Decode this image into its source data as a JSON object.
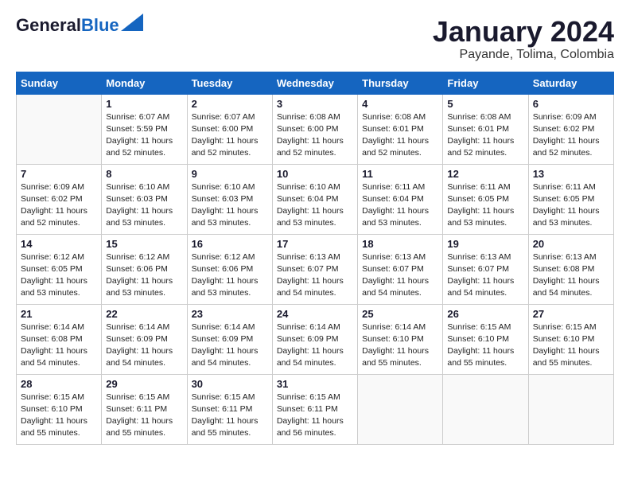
{
  "header": {
    "logo_line1": "General",
    "logo_line2": "Blue",
    "title": "January 2024",
    "subtitle": "Payande, Tolima, Colombia"
  },
  "days_of_week": [
    "Sunday",
    "Monday",
    "Tuesday",
    "Wednesday",
    "Thursday",
    "Friday",
    "Saturday"
  ],
  "weeks": [
    [
      {
        "num": "",
        "info": ""
      },
      {
        "num": "1",
        "info": "Sunrise: 6:07 AM\nSunset: 5:59 PM\nDaylight: 11 hours\nand 52 minutes."
      },
      {
        "num": "2",
        "info": "Sunrise: 6:07 AM\nSunset: 6:00 PM\nDaylight: 11 hours\nand 52 minutes."
      },
      {
        "num": "3",
        "info": "Sunrise: 6:08 AM\nSunset: 6:00 PM\nDaylight: 11 hours\nand 52 minutes."
      },
      {
        "num": "4",
        "info": "Sunrise: 6:08 AM\nSunset: 6:01 PM\nDaylight: 11 hours\nand 52 minutes."
      },
      {
        "num": "5",
        "info": "Sunrise: 6:08 AM\nSunset: 6:01 PM\nDaylight: 11 hours\nand 52 minutes."
      },
      {
        "num": "6",
        "info": "Sunrise: 6:09 AM\nSunset: 6:02 PM\nDaylight: 11 hours\nand 52 minutes."
      }
    ],
    [
      {
        "num": "7",
        "info": "Sunrise: 6:09 AM\nSunset: 6:02 PM\nDaylight: 11 hours\nand 52 minutes."
      },
      {
        "num": "8",
        "info": "Sunrise: 6:10 AM\nSunset: 6:03 PM\nDaylight: 11 hours\nand 53 minutes."
      },
      {
        "num": "9",
        "info": "Sunrise: 6:10 AM\nSunset: 6:03 PM\nDaylight: 11 hours\nand 53 minutes."
      },
      {
        "num": "10",
        "info": "Sunrise: 6:10 AM\nSunset: 6:04 PM\nDaylight: 11 hours\nand 53 minutes."
      },
      {
        "num": "11",
        "info": "Sunrise: 6:11 AM\nSunset: 6:04 PM\nDaylight: 11 hours\nand 53 minutes."
      },
      {
        "num": "12",
        "info": "Sunrise: 6:11 AM\nSunset: 6:05 PM\nDaylight: 11 hours\nand 53 minutes."
      },
      {
        "num": "13",
        "info": "Sunrise: 6:11 AM\nSunset: 6:05 PM\nDaylight: 11 hours\nand 53 minutes."
      }
    ],
    [
      {
        "num": "14",
        "info": "Sunrise: 6:12 AM\nSunset: 6:05 PM\nDaylight: 11 hours\nand 53 minutes."
      },
      {
        "num": "15",
        "info": "Sunrise: 6:12 AM\nSunset: 6:06 PM\nDaylight: 11 hours\nand 53 minutes."
      },
      {
        "num": "16",
        "info": "Sunrise: 6:12 AM\nSunset: 6:06 PM\nDaylight: 11 hours\nand 53 minutes."
      },
      {
        "num": "17",
        "info": "Sunrise: 6:13 AM\nSunset: 6:07 PM\nDaylight: 11 hours\nand 54 minutes."
      },
      {
        "num": "18",
        "info": "Sunrise: 6:13 AM\nSunset: 6:07 PM\nDaylight: 11 hours\nand 54 minutes."
      },
      {
        "num": "19",
        "info": "Sunrise: 6:13 AM\nSunset: 6:07 PM\nDaylight: 11 hours\nand 54 minutes."
      },
      {
        "num": "20",
        "info": "Sunrise: 6:13 AM\nSunset: 6:08 PM\nDaylight: 11 hours\nand 54 minutes."
      }
    ],
    [
      {
        "num": "21",
        "info": "Sunrise: 6:14 AM\nSunset: 6:08 PM\nDaylight: 11 hours\nand 54 minutes."
      },
      {
        "num": "22",
        "info": "Sunrise: 6:14 AM\nSunset: 6:09 PM\nDaylight: 11 hours\nand 54 minutes."
      },
      {
        "num": "23",
        "info": "Sunrise: 6:14 AM\nSunset: 6:09 PM\nDaylight: 11 hours\nand 54 minutes."
      },
      {
        "num": "24",
        "info": "Sunrise: 6:14 AM\nSunset: 6:09 PM\nDaylight: 11 hours\nand 54 minutes."
      },
      {
        "num": "25",
        "info": "Sunrise: 6:14 AM\nSunset: 6:10 PM\nDaylight: 11 hours\nand 55 minutes."
      },
      {
        "num": "26",
        "info": "Sunrise: 6:15 AM\nSunset: 6:10 PM\nDaylight: 11 hours\nand 55 minutes."
      },
      {
        "num": "27",
        "info": "Sunrise: 6:15 AM\nSunset: 6:10 PM\nDaylight: 11 hours\nand 55 minutes."
      }
    ],
    [
      {
        "num": "28",
        "info": "Sunrise: 6:15 AM\nSunset: 6:10 PM\nDaylight: 11 hours\nand 55 minutes."
      },
      {
        "num": "29",
        "info": "Sunrise: 6:15 AM\nSunset: 6:11 PM\nDaylight: 11 hours\nand 55 minutes."
      },
      {
        "num": "30",
        "info": "Sunrise: 6:15 AM\nSunset: 6:11 PM\nDaylight: 11 hours\nand 55 minutes."
      },
      {
        "num": "31",
        "info": "Sunrise: 6:15 AM\nSunset: 6:11 PM\nDaylight: 11 hours\nand 56 minutes."
      },
      {
        "num": "",
        "info": ""
      },
      {
        "num": "",
        "info": ""
      },
      {
        "num": "",
        "info": ""
      }
    ]
  ]
}
